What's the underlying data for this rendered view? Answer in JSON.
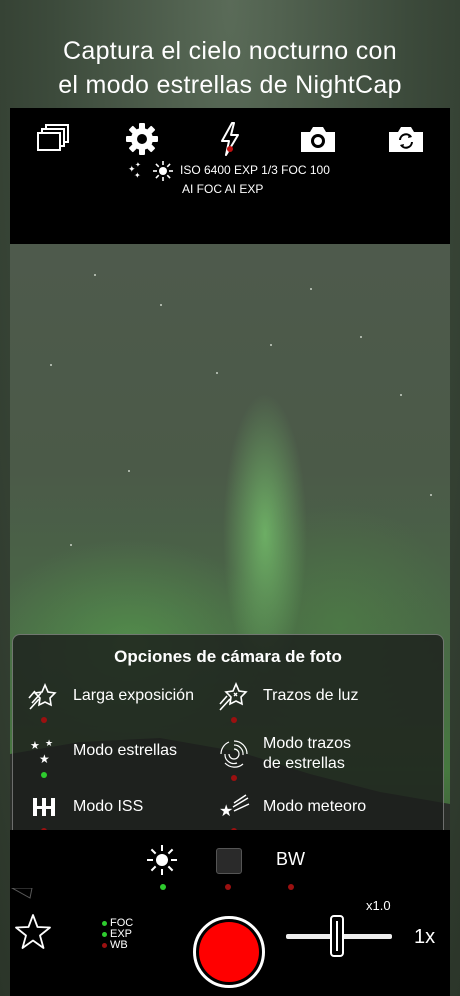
{
  "headline": {
    "line1": "Captura el cielo nocturno con",
    "line2": "el modo estrellas de NightCap"
  },
  "toolbar": {
    "icons": [
      "gallery-icon",
      "gear-icon",
      "flash-icon",
      "camera-icon",
      "switch-camera-icon"
    ]
  },
  "status": {
    "line1": "ISO 6400 EXP 1/3 FOC 100",
    "line2": "AI FOC  AI EXP"
  },
  "panel": {
    "title": "Opciones de cámara de foto",
    "options": [
      {
        "label": "Larga exposición",
        "icon": "long-exposure-icon",
        "active": false
      },
      {
        "label": "Trazos de luz",
        "icon": "light-trails-icon",
        "active": false
      },
      {
        "label": "Modo estrellas",
        "icon": "stars-mode-icon",
        "active": true
      },
      {
        "label": "Modo trazos",
        "label2": "de estrellas",
        "icon": "star-trails-icon",
        "active": false
      },
      {
        "label": "Modo ISS",
        "icon": "iss-icon",
        "active": false
      },
      {
        "label": "Modo meteoro",
        "icon": "meteor-icon",
        "active": false
      }
    ]
  },
  "settings_row": {
    "bw_label": "BW"
  },
  "bottom": {
    "legend": [
      "FOC",
      "EXP",
      "WB"
    ],
    "zoom_multiplier": "x1.0",
    "zoom_label": "1x"
  },
  "colors": {
    "active_dot": "#2ecc2e",
    "inactive_dot": "#9b1010",
    "shutter": "#ff0000"
  }
}
